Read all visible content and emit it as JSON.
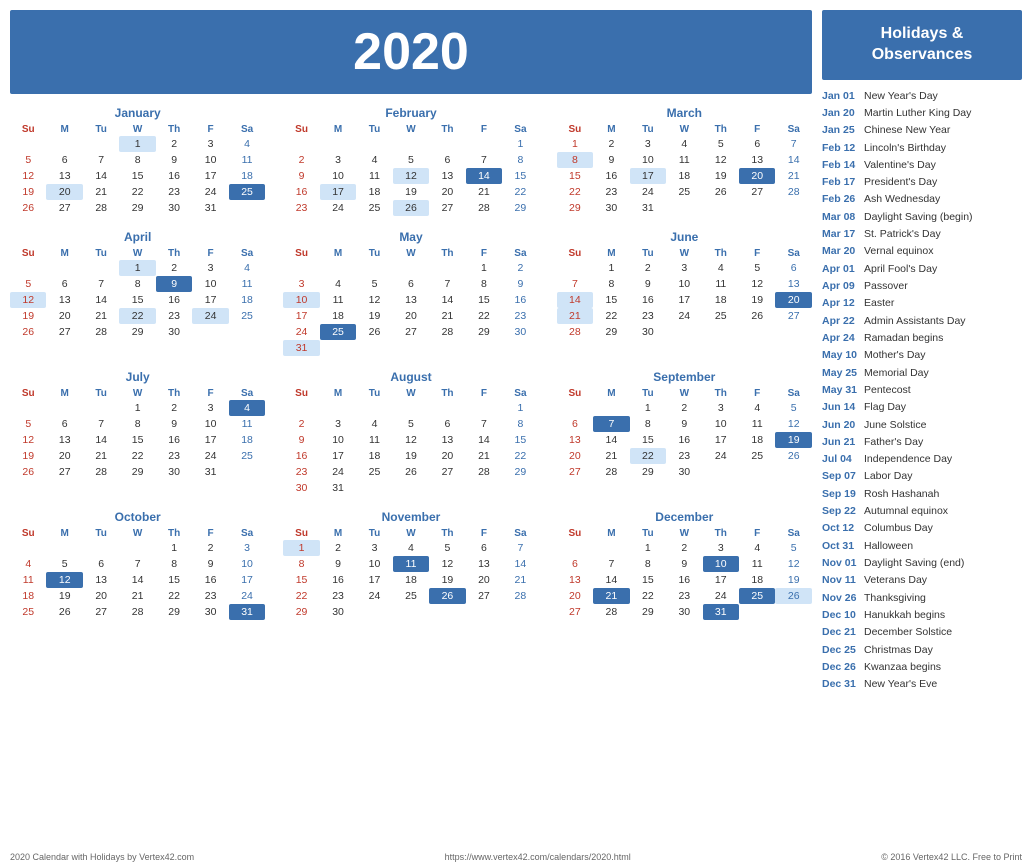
{
  "header": {
    "year": "2020"
  },
  "sidebar": {
    "title": "Holidays &\nObservances",
    "holidays": [
      {
        "date": "Jan 01",
        "name": "New Year's Day"
      },
      {
        "date": "Jan 20",
        "name": "Martin Luther King Day"
      },
      {
        "date": "Jan 25",
        "name": "Chinese New Year"
      },
      {
        "date": "Feb 12",
        "name": "Lincoln's Birthday"
      },
      {
        "date": "Feb 14",
        "name": "Valentine's Day"
      },
      {
        "date": "Feb 17",
        "name": "President's Day"
      },
      {
        "date": "Feb 26",
        "name": "Ash Wednesday"
      },
      {
        "date": "Mar 08",
        "name": "Daylight Saving (begin)"
      },
      {
        "date": "Mar 17",
        "name": "St. Patrick's Day"
      },
      {
        "date": "Mar 20",
        "name": "Vernal equinox"
      },
      {
        "date": "Apr 01",
        "name": "April Fool's Day"
      },
      {
        "date": "Apr 09",
        "name": "Passover"
      },
      {
        "date": "Apr 12",
        "name": "Easter"
      },
      {
        "date": "Apr 22",
        "name": "Admin Assistants Day"
      },
      {
        "date": "Apr 24",
        "name": "Ramadan begins"
      },
      {
        "date": "May 10",
        "name": "Mother's Day"
      },
      {
        "date": "May 25",
        "name": "Memorial Day"
      },
      {
        "date": "May 31",
        "name": "Pentecost"
      },
      {
        "date": "Jun 14",
        "name": "Flag Day"
      },
      {
        "date": "Jun 20",
        "name": "June Solstice"
      },
      {
        "date": "Jun 21",
        "name": "Father's Day"
      },
      {
        "date": "Jul 04",
        "name": "Independence Day"
      },
      {
        "date": "Sep 07",
        "name": "Labor Day"
      },
      {
        "date": "Sep 19",
        "name": "Rosh Hashanah"
      },
      {
        "date": "Sep 22",
        "name": "Autumnal equinox"
      },
      {
        "date": "Oct 12",
        "name": "Columbus Day"
      },
      {
        "date": "Oct 31",
        "name": "Halloween"
      },
      {
        "date": "Nov 01",
        "name": "Daylight Saving (end)"
      },
      {
        "date": "Nov 11",
        "name": "Veterans Day"
      },
      {
        "date": "Nov 26",
        "name": "Thanksgiving"
      },
      {
        "date": "Dec 10",
        "name": "Hanukkah begins"
      },
      {
        "date": "Dec 21",
        "name": "December Solstice"
      },
      {
        "date": "Dec 25",
        "name": "Christmas Day"
      },
      {
        "date": "Dec 26",
        "name": "Kwanzaa begins"
      },
      {
        "date": "Dec 31",
        "name": "New Year's Eve"
      }
    ]
  },
  "footer": {
    "left": "2020 Calendar with Holidays by Vertex42.com",
    "center": "https://www.vertex42.com/calendars/2020.html",
    "right": "© 2016 Vertex42 LLC. Free to Print"
  },
  "months": [
    {
      "name": "January",
      "weeks": [
        [
          null,
          null,
          null,
          "1h",
          "2",
          "3",
          "4s"
        ],
        [
          "5u",
          "6",
          "7",
          "8",
          "9",
          "10",
          "11s"
        ],
        [
          "12u",
          "13",
          "14",
          "15",
          "16",
          "17",
          "18s"
        ],
        [
          "19u",
          "20h",
          "21",
          "22",
          "23",
          "24",
          "25hs"
        ],
        [
          "26u",
          "27",
          "28",
          "29",
          "30",
          "31",
          null
        ]
      ]
    },
    {
      "name": "February",
      "weeks": [
        [
          null,
          null,
          null,
          null,
          null,
          null,
          "1s"
        ],
        [
          "2u",
          "3",
          "4",
          "5",
          "6",
          "7",
          "8s"
        ],
        [
          "9u",
          "10",
          "11",
          "12h",
          "13",
          "14h",
          "15s"
        ],
        [
          "16u",
          "17h",
          "18",
          "19",
          "20",
          "21",
          "22s"
        ],
        [
          "23u",
          "24",
          "25",
          "26h",
          "27",
          "28",
          "29s"
        ]
      ]
    },
    {
      "name": "March",
      "weeks": [
        [
          "1u",
          "2",
          "3",
          "4",
          "5",
          "6",
          "7s"
        ],
        [
          "8uh",
          "9",
          "10",
          "11",
          "12",
          "13",
          "14s"
        ],
        [
          "15u",
          "16",
          "17h",
          "18",
          "19",
          "20h",
          "21s"
        ],
        [
          "22u",
          "23",
          "24",
          "25",
          "26",
          "27",
          "28s"
        ],
        [
          "29u",
          "30",
          "31",
          null,
          null,
          null,
          null
        ]
      ]
    },
    {
      "name": "April",
      "weeks": [
        [
          null,
          null,
          null,
          "1h",
          "2",
          "3",
          "4s"
        ],
        [
          "5u",
          "6",
          "7",
          "8",
          "9h",
          "10",
          "11s"
        ],
        [
          "12uh",
          "13",
          "14",
          "15",
          "16",
          "17",
          "18s"
        ],
        [
          "19u",
          "20",
          "21",
          "22h",
          "23",
          "24h",
          "25s"
        ],
        [
          "26u",
          "27",
          "28",
          "29",
          "30",
          null,
          null
        ]
      ]
    },
    {
      "name": "May",
      "weeks": [
        [
          null,
          null,
          null,
          null,
          null,
          "1",
          "2s"
        ],
        [
          "3u",
          "4",
          "5",
          "6",
          "7",
          "8",
          "9s"
        ],
        [
          "10uh",
          "11",
          "12",
          "13",
          "14",
          "15",
          "16s"
        ],
        [
          "17u",
          "18",
          "19",
          "20",
          "21",
          "22",
          "23s"
        ],
        [
          "24u",
          "25h",
          "26",
          "27",
          "28",
          "29",
          "30s"
        ],
        [
          "31uh",
          null,
          null,
          null,
          null,
          null,
          null
        ]
      ]
    },
    {
      "name": "June",
      "weeks": [
        [
          null,
          "1",
          "2",
          "3",
          "4",
          "5",
          "6s"
        ],
        [
          "7u",
          "8",
          "9",
          "10",
          "11",
          "12",
          "13s"
        ],
        [
          "14uh",
          "15",
          "16",
          "17",
          "18",
          "19",
          "20hs"
        ],
        [
          "21uh",
          "22",
          "23",
          "24",
          "25",
          "26",
          "27s"
        ],
        [
          "28u",
          "29",
          "30",
          null,
          null,
          null,
          null
        ]
      ]
    },
    {
      "name": "July",
      "weeks": [
        [
          null,
          null,
          null,
          "1",
          "2",
          "3",
          "4hs"
        ],
        [
          "5u",
          "6",
          "7",
          "8",
          "9",
          "10",
          "11s"
        ],
        [
          "12u",
          "13",
          "14",
          "15",
          "16",
          "17",
          "18s"
        ],
        [
          "19u",
          "20",
          "21",
          "22",
          "23",
          "24",
          "25s"
        ],
        [
          "26u",
          "27",
          "28",
          "29",
          "30",
          "31",
          null
        ]
      ]
    },
    {
      "name": "August",
      "weeks": [
        [
          null,
          null,
          null,
          null,
          null,
          null,
          "1s"
        ],
        [
          "2u",
          "3",
          "4",
          "5",
          "6",
          "7",
          "8s"
        ],
        [
          "9u",
          "10",
          "11",
          "12",
          "13",
          "14",
          "15s"
        ],
        [
          "16u",
          "17",
          "18",
          "19",
          "20",
          "21",
          "22s"
        ],
        [
          "23u",
          "24",
          "25",
          "26",
          "27",
          "28",
          "29s"
        ],
        [
          "30u",
          "31",
          null,
          null,
          null,
          null,
          null
        ]
      ]
    },
    {
      "name": "September",
      "weeks": [
        [
          null,
          null,
          "1",
          "2",
          "3",
          "4",
          "5s"
        ],
        [
          "6u",
          "7h",
          "8",
          "9",
          "10",
          "11",
          "12s"
        ],
        [
          "13u",
          "14",
          "15",
          "16",
          "17",
          "18",
          "19hs"
        ],
        [
          "20u",
          "21",
          "22h",
          "23",
          "24",
          "25",
          "26s"
        ],
        [
          "27u",
          "28",
          "29",
          "30",
          null,
          null,
          null
        ]
      ]
    },
    {
      "name": "October",
      "weeks": [
        [
          null,
          null,
          null,
          null,
          "1",
          "2",
          "3s"
        ],
        [
          "4u",
          "5",
          "6",
          "7",
          "8",
          "9",
          "10s"
        ],
        [
          "11u",
          "12h",
          "13",
          "14",
          "15",
          "16",
          "17s"
        ],
        [
          "18u",
          "19",
          "20",
          "21",
          "22",
          "23",
          "24s"
        ],
        [
          "25u",
          "26",
          "27",
          "28",
          "29",
          "30",
          "31hs"
        ]
      ]
    },
    {
      "name": "November",
      "weeks": [
        [
          "1uh",
          "2",
          "3",
          "4",
          "5",
          "6",
          "7s"
        ],
        [
          "8u",
          "9",
          "10",
          "11h",
          "12",
          "13",
          "14s"
        ],
        [
          "15u",
          "16",
          "17",
          "18",
          "19",
          "20",
          "21s"
        ],
        [
          "22u",
          "23",
          "24",
          "25",
          "26h",
          "27",
          "28s"
        ],
        [
          "29u",
          "30",
          null,
          null,
          null,
          null,
          null
        ]
      ]
    },
    {
      "name": "December",
      "weeks": [
        [
          null,
          null,
          "1",
          "2",
          "3",
          "4",
          "5s"
        ],
        [
          "6u",
          "7",
          "8",
          "9",
          "10h",
          "11",
          "12s"
        ],
        [
          "13u",
          "14",
          "15",
          "16",
          "17",
          "18",
          "19s"
        ],
        [
          "20u",
          "21h",
          "22",
          "23",
          "24",
          "25hs",
          "26hs"
        ],
        [
          "27u",
          "28",
          "29",
          "30",
          "31h",
          null,
          null
        ]
      ]
    }
  ]
}
